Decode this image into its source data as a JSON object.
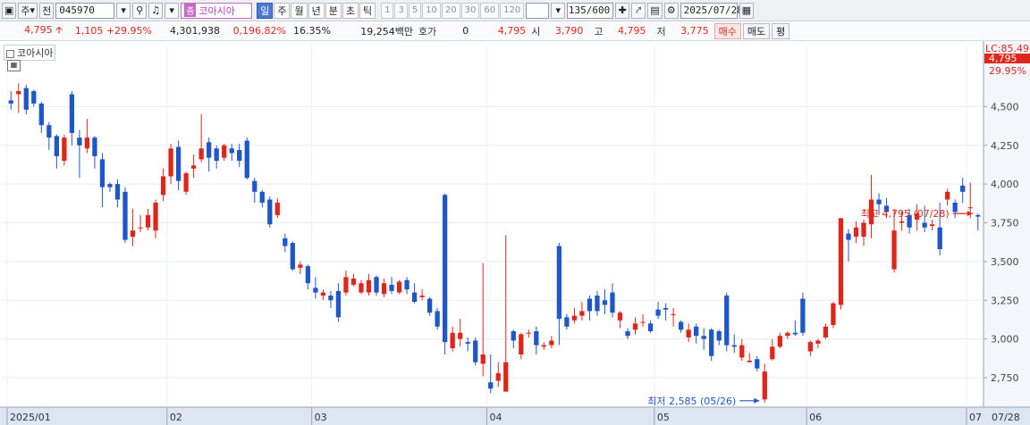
{
  "toolbar": {
    "market": "주",
    "prev_label": "전",
    "code": "045970",
    "type_badge": "종",
    "name": "코아시아",
    "periods": [
      "일",
      "주",
      "월",
      "년",
      "분",
      "초",
      "틱"
    ],
    "active_period": "일",
    "intervals": [
      "1",
      "3",
      "5",
      "10",
      "20",
      "30",
      "60",
      "120"
    ],
    "count": "135/600",
    "date": "2025/07/28"
  },
  "quote": {
    "price": "4,795",
    "change": "1,105 +29.95%",
    "volume": "4,301,938",
    "volume_ratio": "0,196.82%",
    "turnover": "16.35%",
    "amount": "19,254백만",
    "hoga_label": "호가",
    "hoga_value": "0",
    "hoga_price": "4,795",
    "open_label": "시",
    "open": "3,790",
    "high_label": "고",
    "high": "4,795",
    "low_label": "저",
    "low": "3,775",
    "buy_label": "매수",
    "sell_label": "매도",
    "eval_label": "평"
  },
  "chart_title": "코아시아",
  "chart_data": {
    "type": "candlestick",
    "title": "코아시아",
    "ylim": [
      2560,
      4900
    ],
    "y_ticks": [
      "4,500",
      "4,250",
      "4,000",
      "3,750",
      "3,500",
      "3,250",
      "3,000",
      "2,750"
    ],
    "x_labels": [
      "2025/01",
      "02",
      "03",
      "04",
      "05",
      "06",
      "07",
      "07/28"
    ],
    "axis_top_labels": [
      "LC:85.49",
      "4,795",
      "29.95%"
    ],
    "annotations": {
      "high": "최고 4,795 (07/28)",
      "low": "최저 2,585 (05/26)"
    },
    "colors": {
      "up": "#e0261b",
      "down": "#1f56c8"
    },
    "candles": [
      [
        4540,
        4600,
        4480,
        4520
      ],
      [
        4580,
        4650,
        4460,
        4600
      ],
      [
        4620,
        4640,
        4450,
        4480
      ],
      [
        4600,
        4610,
        4500,
        4520
      ],
      [
        4520,
        4530,
        4330,
        4380
      ],
      [
        4380,
        4400,
        4220,
        4300
      ],
      [
        4310,
        4320,
        4100,
        4180
      ],
      [
        4150,
        4320,
        4120,
        4300
      ],
      [
        4580,
        4600,
        4250,
        4330
      ],
      [
        4300,
        4350,
        4040,
        4250
      ],
      [
        4230,
        4420,
        4200,
        4300
      ],
      [
        4300,
        4310,
        4100,
        4180
      ],
      [
        4160,
        4200,
        3850,
        3980
      ],
      [
        4000,
        4010,
        3950,
        3980
      ],
      [
        4000,
        4030,
        3850,
        3900
      ],
      [
        3950,
        3980,
        3620,
        3640
      ],
      [
        3660,
        3840,
        3600,
        3700
      ],
      [
        3720,
        3800,
        3690,
        3720
      ],
      [
        3720,
        3840,
        3700,
        3800
      ],
      [
        3700,
        3900,
        3650,
        3880
      ],
      [
        3930,
        4100,
        3890,
        4050
      ],
      [
        4050,
        4260,
        4000,
        4230
      ],
      [
        4240,
        4280,
        3960,
        4020
      ],
      [
        3950,
        4080,
        3930,
        4070
      ],
      [
        4100,
        4190,
        4040,
        4120
      ],
      [
        4160,
        4450,
        4140,
        4230
      ],
      [
        4270,
        4300,
        4080,
        4170
      ],
      [
        4230,
        4250,
        4100,
        4150
      ],
      [
        4170,
        4260,
        4150,
        4250
      ],
      [
        4230,
        4260,
        4150,
        4200
      ],
      [
        4220,
        4260,
        4110,
        4150
      ],
      [
        4280,
        4300,
        4030,
        4040
      ],
      [
        4020,
        4040,
        3880,
        3950
      ],
      [
        3950,
        3960,
        3850,
        3880
      ],
      [
        3900,
        3920,
        3720,
        3740
      ],
      [
        3800,
        3910,
        3780,
        3880
      ],
      [
        3650,
        3680,
        3560,
        3600
      ],
      [
        3620,
        3630,
        3440,
        3450
      ],
      [
        3460,
        3500,
        3420,
        3480
      ],
      [
        3470,
        3480,
        3320,
        3360
      ],
      [
        3330,
        3400,
        3260,
        3300
      ],
      [
        3280,
        3320,
        3250,
        3300
      ],
      [
        3280,
        3310,
        3200,
        3250
      ],
      [
        3310,
        3360,
        3110,
        3140
      ],
      [
        3300,
        3440,
        3280,
        3400
      ],
      [
        3350,
        3420,
        3340,
        3390
      ],
      [
        3300,
        3380,
        3290,
        3360
      ],
      [
        3300,
        3420,
        3280,
        3380
      ],
      [
        3400,
        3410,
        3280,
        3300
      ],
      [
        3290,
        3390,
        3270,
        3360
      ],
      [
        3350,
        3400,
        3290,
        3310
      ],
      [
        3300,
        3380,
        3290,
        3370
      ],
      [
        3380,
        3400,
        3290,
        3320
      ],
      [
        3300,
        3360,
        3230,
        3240
      ],
      [
        3270,
        3320,
        3250,
        3280
      ],
      [
        3260,
        3270,
        3150,
        3170
      ],
      [
        3180,
        3200,
        3060,
        3080
      ],
      [
        3930,
        3940,
        2900,
        2980
      ],
      [
        2940,
        3080,
        2920,
        3040
      ],
      [
        3000,
        3130,
        2950,
        3040
      ],
      [
        2980,
        3010,
        2920,
        2970
      ],
      [
        2990,
        3010,
        2830,
        2850
      ],
      [
        2840,
        3490,
        2760,
        2900
      ],
      [
        2720,
        2900,
        2650,
        2680
      ],
      [
        2730,
        2850,
        2690,
        2780
      ],
      [
        2660,
        3670,
        2680,
        2850
      ],
      [
        3050,
        3060,
        2940,
        2990
      ],
      [
        2900,
        3040,
        2870,
        3030
      ],
      [
        3040,
        3060,
        3010,
        3040
      ],
      [
        3050,
        3080,
        2900,
        2960
      ],
      [
        2950,
        2980,
        2930,
        2960
      ],
      [
        2960,
        3020,
        2940,
        2990
      ],
      [
        3600,
        3620,
        2960,
        3130
      ],
      [
        3140,
        3160,
        3060,
        3080
      ],
      [
        3120,
        3200,
        3100,
        3150
      ],
      [
        3150,
        3240,
        3120,
        3180
      ],
      [
        3260,
        3280,
        3120,
        3180
      ],
      [
        3280,
        3310,
        3150,
        3180
      ],
      [
        3250,
        3320,
        3160,
        3220
      ],
      [
        3300,
        3360,
        3140,
        3170
      ],
      [
        3120,
        3180,
        3070,
        3170
      ],
      [
        3050,
        3070,
        3000,
        3020
      ],
      [
        3060,
        3140,
        3030,
        3100
      ],
      [
        3110,
        3160,
        3080,
        3110
      ],
      [
        3100,
        3120,
        3040,
        3050
      ],
      [
        3190,
        3240,
        3130,
        3150
      ],
      [
        3200,
        3230,
        3120,
        3190
      ],
      [
        3160,
        3200,
        3080,
        3160
      ],
      [
        3110,
        3120,
        3040,
        3060
      ],
      [
        3010,
        3100,
        2980,
        3060
      ],
      [
        3080,
        3100,
        2970,
        3020
      ],
      [
        3020,
        3070,
        2930,
        3000
      ],
      [
        3060,
        3070,
        2860,
        2890
      ],
      [
        3050,
        3060,
        2960,
        2990
      ],
      [
        3280,
        3300,
        2920,
        2960
      ],
      [
        2960,
        3030,
        2910,
        2950
      ],
      [
        2880,
        3000,
        2860,
        2960
      ],
      [
        2850,
        2910,
        2850,
        2860
      ],
      [
        2870,
        2890,
        2790,
        2810
      ],
      [
        2610,
        2840,
        2590,
        2790
      ],
      [
        2870,
        3000,
        2860,
        2950
      ],
      [
        2950,
        3040,
        2940,
        3020
      ],
      [
        3020,
        3050,
        3000,
        3040
      ],
      [
        3040,
        3120,
        3020,
        3030
      ],
      [
        3260,
        3300,
        3020,
        3040
      ],
      [
        2920,
        2990,
        2890,
        2980
      ],
      [
        2970,
        3000,
        2940,
        2990
      ],
      [
        3010,
        3100,
        3000,
        3080
      ],
      [
        3090,
        3240,
        3070,
        3230
      ],
      [
        3220,
        3780,
        3190,
        3780
      ],
      [
        3680,
        3710,
        3500,
        3640
      ],
      [
        3660,
        3760,
        3620,
        3720
      ],
      [
        3660,
        3770,
        3600,
        3750
      ],
      [
        3740,
        4060,
        3650,
        3900
      ],
      [
        3900,
        3940,
        3800,
        3870
      ],
      [
        3860,
        3910,
        3780,
        3820
      ],
      [
        3450,
        3840,
        3430,
        3700
      ],
      [
        3750,
        3830,
        3700,
        3760
      ],
      [
        3800,
        3840,
        3680,
        3720
      ],
      [
        3770,
        3870,
        3700,
        3810
      ],
      [
        3750,
        3860,
        3690,
        3720
      ],
      [
        3730,
        3770,
        3700,
        3740
      ],
      [
        3720,
        3880,
        3540,
        3580
      ],
      [
        3900,
        3970,
        3860,
        3950
      ],
      [
        3880,
        3900,
        3780,
        3820
      ],
      [
        3990,
        4040,
        3880,
        3950
      ],
      [
        3850,
        4010,
        3780,
        3850
      ],
      [
        3800,
        3810,
        3700,
        3790
      ]
    ]
  }
}
